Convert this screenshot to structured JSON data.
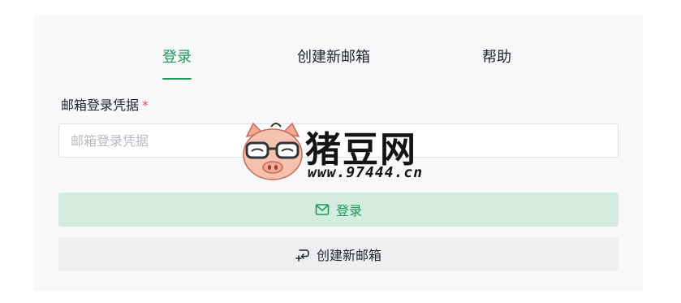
{
  "tabs": [
    {
      "label": "登录",
      "active": true
    },
    {
      "label": "创建新邮箱",
      "active": false
    },
    {
      "label": "帮助",
      "active": false
    }
  ],
  "form": {
    "credential_label": "邮箱登录凭据",
    "required_mark": "*",
    "credential_placeholder": "邮箱登录凭据",
    "credential_value": ""
  },
  "buttons": {
    "login_label": "登录",
    "login_icon": "mail-icon",
    "create_label": "创建新邮箱",
    "create_icon": "create-mailbox-icon"
  },
  "watermark": {
    "title": "猪豆网",
    "url": "www.97444.cn",
    "logo_icon": "pig-logo-icon"
  },
  "colors": {
    "accent": "#1e9a55",
    "accent_light": "#d3ecdf",
    "secondary_button": "#eeeff1",
    "required": "#e34d59",
    "card_background": "#f7f8fa"
  }
}
